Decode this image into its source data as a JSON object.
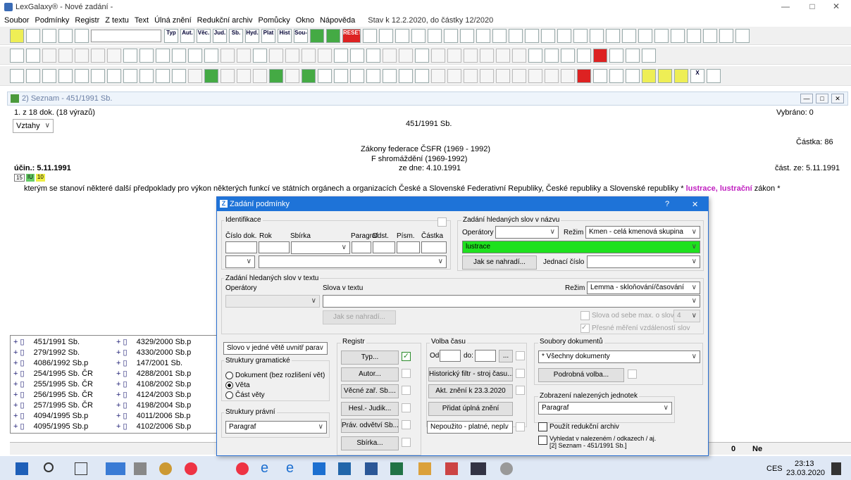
{
  "app": {
    "title": "LexGalaxy® - Nové zadání -"
  },
  "menu": [
    "Soubor",
    "Podmínky",
    "Registr",
    "Z textu",
    "Text",
    "Úlná znění",
    "Redukční archiv",
    "Pomůcky",
    "Okno",
    "Nápověda"
  ],
  "menu_status": "Stav k 12.2.2020, do částky 12/2020",
  "window_controls": {
    "minimize": "—",
    "maximize": "□",
    "close": "✕"
  },
  "toolbar1": [
    "Typ",
    "Aut.",
    "Věc.",
    "Jud.",
    "Sb.",
    "Hyd.",
    "Plat",
    "Hist",
    "Sou-",
    "RESET"
  ],
  "seznam": {
    "title": "2) Seznam - 451/1991 Sb.",
    "counter": "1. z 18 dok. (18 výrazů)",
    "vybrano": "Vybráno: 0",
    "vztahy": "Vztahy",
    "doc_id": "451/1991 Sb.",
    "castka": "Částka: 86",
    "issuer1": "Zákony federace ČSFR (1969 - 1992)",
    "issuer2": "F shromáždění (1969-1992)",
    "date": "ze dne: 4.10.1991",
    "ucin": "účin.: 5.11.1991",
    "cast_ze": "část. ze: 5.11.1991",
    "badges": [
      "15",
      "IU",
      "10"
    ],
    "subject": "kterým se stanoví některé další předpoklady pro výkon některých funkcí ve státních orgánech a organizacích České a Slovenské Federativní Republiky, České republiky a Slovenské republiky *",
    "highlight": "lustrace, lustrační",
    "subject_tail": "zákon *"
  },
  "doclist": {
    "left": [
      "451/1991 Sb.",
      "279/1992 Sb.",
      "4086/1992 Sb.p",
      "254/1995 Sb. ČR",
      "255/1995 Sb. ČR",
      "256/1995 Sb. ČR",
      "257/1995 Sb. ČR",
      "4094/1995 Sb.p",
      "4095/1995 Sb.p"
    ],
    "right": [
      "4329/2000 Sb.p",
      "4330/2000 Sb.p",
      "147/2001 Sb.",
      "4288/2001 Sb.p",
      "4108/2002 Sb.p",
      "4124/2003 Sb.p",
      "4198/2004 Sb.p",
      "4011/2006 Sb.p",
      "4102/2006 Sb.p"
    ]
  },
  "status": {
    "zero": "0",
    "ne": "Ne"
  },
  "dialog": {
    "title": "Zadání podmínky",
    "help": "?",
    "close": "✕",
    "ident": {
      "label": "Identifikace",
      "cislo": "Číslo dok.",
      "rok": "Rok",
      "sbirka": "Sbírka",
      "paragraf": "Paragraf",
      "odst": "Odst.",
      "pism": "Písm.",
      "castka": "Částka"
    },
    "nazev": {
      "label": "Zadání hledaných slov v názvu",
      "operatory": "Operátory",
      "rezim": "Režim",
      "rezim_value": "Kmen - celá kmenová skupina",
      "search_value": "lustrace",
      "jak_btn": "Jak se nahradí...",
      "jednaci": "Jednací číslo"
    },
    "text": {
      "label": "Zadání hledaných slov v textu",
      "operatory": "Operátory",
      "slova": "Slova v textu",
      "rezim": "Režim",
      "rezim_value": "Lemma - skloňování/časování",
      "jak_btn": "Jak se nahradí...",
      "slova_od": "Slova od sebe max. o slov",
      "slova_od_value": "4",
      "presne": "Přesné měření vzdáleností slov"
    },
    "left": {
      "mode": "Slovo v jedné větě uvnitř para",
      "struktury_gram": "Struktury gramatické",
      "radios": [
        "Dokument (bez rozlišení vět)",
        "Věta",
        "Část věty"
      ],
      "struktury_pravni": "Struktury právní",
      "pravni_value": "Paragraf"
    },
    "registr": {
      "label": "Registr",
      "buttons": [
        "Typ...",
        "Autor...",
        "Věcné zař. Sb....",
        "Hesl.- Judik...",
        "Práv. odvětví Sb...",
        "Sbírka..."
      ]
    },
    "volba": {
      "label": "Volba času",
      "od": "Od:",
      "do": "do:",
      "ellipsis": "...",
      "hist": "Historický filtr - stroj času...",
      "akt": "Akt. znění k 23.3.2020",
      "pridat": "Přidat úplná znění",
      "nepouzito": "Nepoužito - platné, nepl."
    },
    "soubory": {
      "label": "Soubory dokumentů",
      "value": "* Všechny dokumenty",
      "podrobna": "Podrobná volba..."
    },
    "zobrazeni": {
      "label": "Zobrazení nalezených jednotek",
      "value": "Paragraf"
    },
    "redukcni": "Použít redukční archiv",
    "vyhledat1": "Vyhledat v nalezeném / odkazech / aj.",
    "vyhledat2": "[2] Seznam - 451/1991 Sb.]"
  },
  "taskbar": {
    "lang": "CES",
    "time": "23:13",
    "date": "23.03.2020"
  }
}
